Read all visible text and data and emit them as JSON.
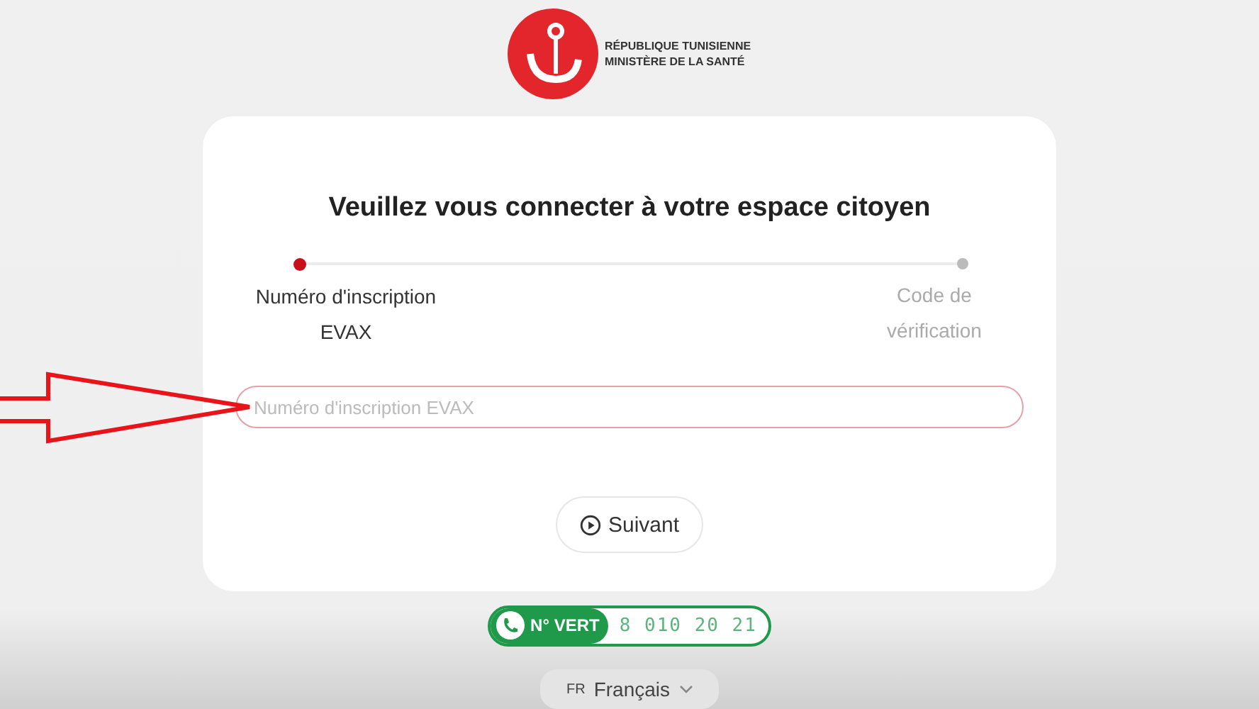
{
  "header": {
    "line_1": "RÉPUBLIQUE TUNISIENNE",
    "line_2": "MINISTÈRE DE LA SANTÉ"
  },
  "card": {
    "title": "Veuillez vous connecter à votre espace citoyen",
    "steps": [
      {
        "label": "Numéro d'inscription EVAX",
        "selected": true
      },
      {
        "label": "Code de vérification",
        "selected": false
      }
    ],
    "field": {
      "placeholder": "Numéro d'inscription EVAX"
    },
    "button": {
      "label": "Suivant"
    }
  },
  "hotline": {
    "label": "N° VERT",
    "number": "8 010 20 21"
  },
  "language": {
    "code": "FR",
    "label": "Français"
  }
}
